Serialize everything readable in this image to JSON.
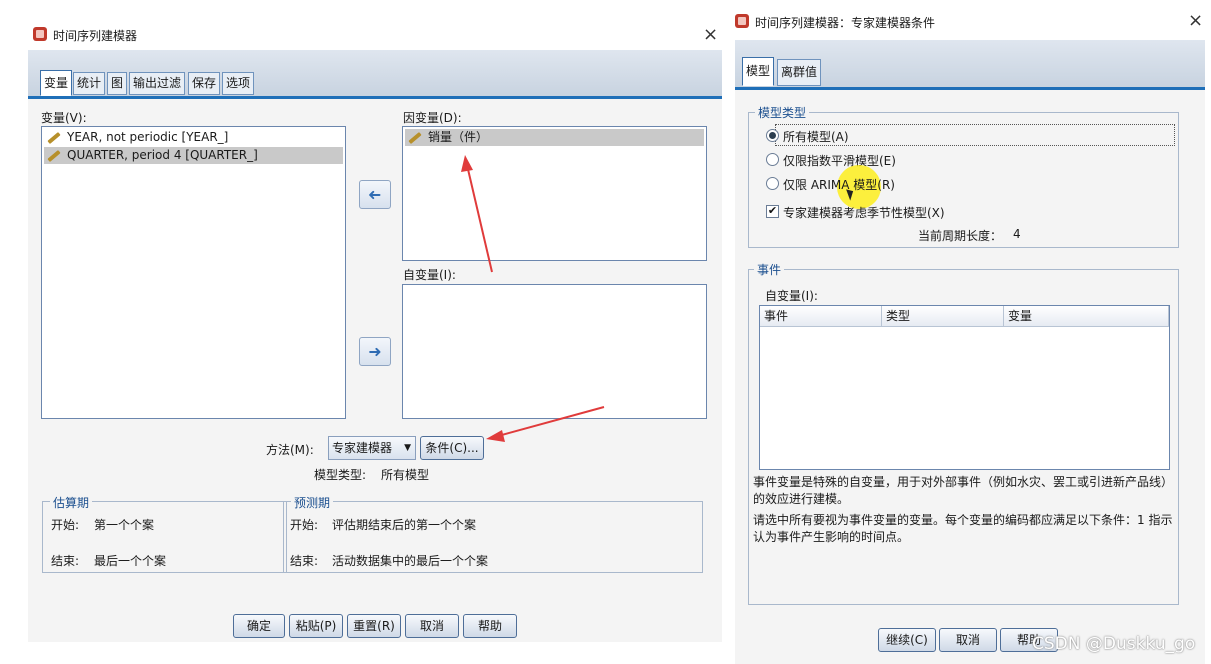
{
  "left_dialog": {
    "title": "时间序列建模器",
    "close": "×",
    "tabs": [
      "变量",
      "统计",
      "图",
      "输出过滤",
      "保存",
      "选项"
    ],
    "variables_label": "变量(V):",
    "variables": [
      "YEAR, not periodic [YEAR_]",
      "QUARTER, period 4 [QUARTER_]"
    ],
    "dependent_label": "因变量(D):",
    "dependent_items": [
      "销量（件）"
    ],
    "independent_label": "自变量(I):",
    "move_right_glyph": "➜",
    "method_label": "方法(M):",
    "method_value": "专家建模器",
    "criteria_button": "条件(C)...",
    "model_type_label": "模型类型:",
    "model_type_value": "所有模型",
    "estimation": {
      "title": "估算期",
      "start_label": "开始:",
      "start_value": "第一个个案",
      "end_label": "结束:",
      "end_value": "最后一个个案"
    },
    "forecast": {
      "title": "预测期",
      "start_label": "开始:",
      "start_value": "评估期结束后的第一个个案",
      "end_label": "结束:",
      "end_value": "活动数据集中的最后一个个案"
    },
    "buttons": {
      "ok": "确定",
      "paste": "粘贴(P)",
      "reset": "重置(R)",
      "cancel": "取消",
      "help": "帮助"
    }
  },
  "right_dialog": {
    "title": "时间序列建模器：专家建模器条件",
    "close": "×",
    "tabs": [
      "模型",
      "离群值"
    ],
    "model_type_group": "模型类型",
    "radios": [
      {
        "label": "所有模型(A)",
        "selected": true
      },
      {
        "label": "仅限指数平滑模型(E)",
        "selected": false
      },
      {
        "label": "仅限 ARIMA 模型(R)",
        "selected": false
      }
    ],
    "seasonal_checkbox": {
      "label": "专家建模器考虑季节性模型(X)",
      "checked": true,
      "mark": "✔"
    },
    "period_label": "当前周期长度：",
    "period_value": "4",
    "events_group": "事件",
    "independent_label": "自变量(I):",
    "table_headers": [
      "事件",
      "类型",
      "变量"
    ],
    "desc1": "事件变量是特殊的自变量，用于对外部事件（例如水灾、罢工或引进新产品线）的效应进行建模。",
    "desc2": "请选中所有要视为事件变量的变量。每个变量的编码都应满足以下条件：1 指示认为事件产生影响的时间点。",
    "buttons": {
      "continue": "继续(C)",
      "cancel": "取消",
      "help": "帮助"
    }
  },
  "watermark": "CSDN @Duskku_go",
  "colors": {
    "accent": "#1f6fb8",
    "annotation": "#e03b3b",
    "highlight": "#ffee00"
  }
}
